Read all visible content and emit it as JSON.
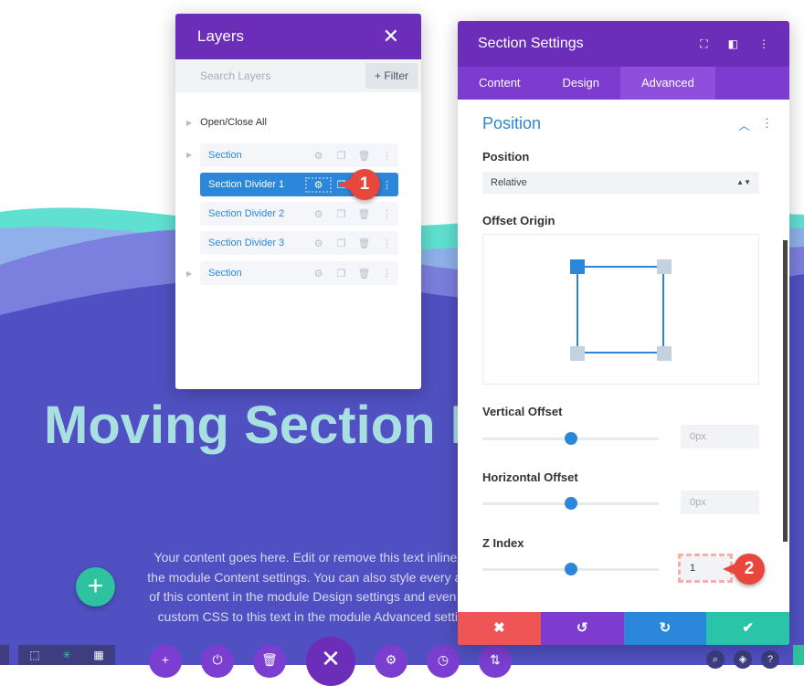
{
  "page": {
    "hero_title": "Moving Section D",
    "body_text": "Your content goes here. Edit or remove this text inline or in the module Content settings. You can also style every aspect of this content in the module Design settings and even apply custom CSS to this text in the module Advanced settings.",
    "add_icon": "+"
  },
  "colors": {
    "purple": "#6c2eb9",
    "blue": "#2b87da",
    "red": "#ef5555",
    "green": "#29c4a9",
    "badge": "#e8473c"
  },
  "layers": {
    "title": "Layers",
    "close": "✕",
    "search_placeholder": "Search Layers",
    "filter": "+ Filter",
    "open_close_all": "Open/Close All",
    "items": [
      {
        "label": "Section"
      },
      {
        "label": "Section Divider 1"
      },
      {
        "label": "Section Divider 2"
      },
      {
        "label": "Section Divider 3"
      },
      {
        "label": "Section"
      }
    ]
  },
  "badges": [
    "1",
    "2"
  ],
  "settings": {
    "title": "Section Settings",
    "tabs": [
      "Content",
      "Design",
      "Advanced"
    ],
    "active_tab": "Advanced",
    "group_title": "Position",
    "position_label": "Position",
    "position_value": "Relative",
    "offset_origin_label": "Offset Origin",
    "offset_origin_value": "top left",
    "vertical_offset_label": "Vertical Offset",
    "vertical_offset_value": "0px",
    "vertical_offset_placeholder": "0px",
    "horizontal_offset_label": "Horizontal Offset",
    "horizontal_offset_value": "0px",
    "z_index_label": "Z Index",
    "z_index_value": "1",
    "footer_icons": [
      "✖",
      "↺",
      "↻",
      "✔"
    ]
  }
}
